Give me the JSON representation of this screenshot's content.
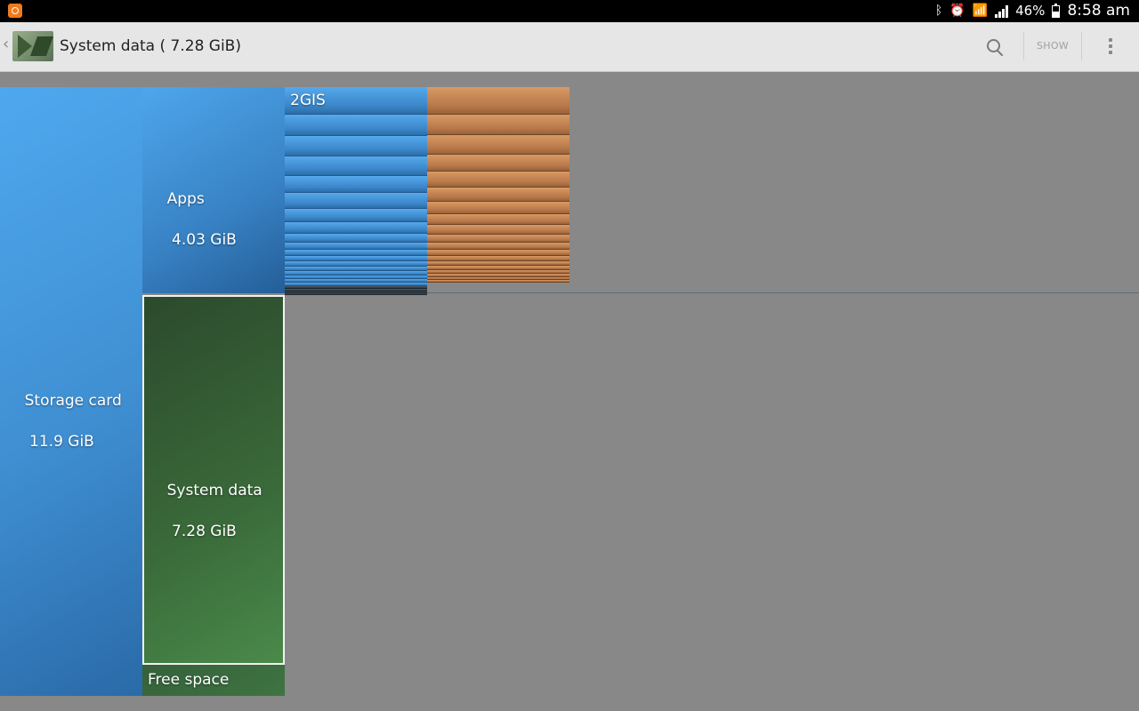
{
  "status_bar": {
    "battery": "46%",
    "time": "8:58 am",
    "icons": [
      "notification-icon",
      "bluetooth-icon",
      "alarm-icon",
      "wifi-icon",
      "signal-icon",
      "battery-icon"
    ]
  },
  "action_bar": {
    "title": "System data ( 7.28 GiB)",
    "show_label": "SHOW",
    "icons": [
      "up-chevron-icon",
      "app-icon",
      "search-icon",
      "overflow-menu-icon"
    ]
  },
  "treemap": {
    "storage_card": {
      "name": "Storage card",
      "size": " 11.9 GiB"
    },
    "apps": {
      "name": "Apps",
      "size": " 4.03 GiB"
    },
    "system_data": {
      "name": "System data",
      "size": " 7.28 GiB"
    },
    "free_space": {
      "name": "Free space"
    },
    "first_app": {
      "name": "2GIS"
    },
    "colors": {
      "storage": "#3f8fd2",
      "apps": "#3882c4",
      "system": "#3a6a3a",
      "app_tiles": "#3b86c9",
      "other_tiles": "#b8784a",
      "background": "#888888"
    }
  }
}
